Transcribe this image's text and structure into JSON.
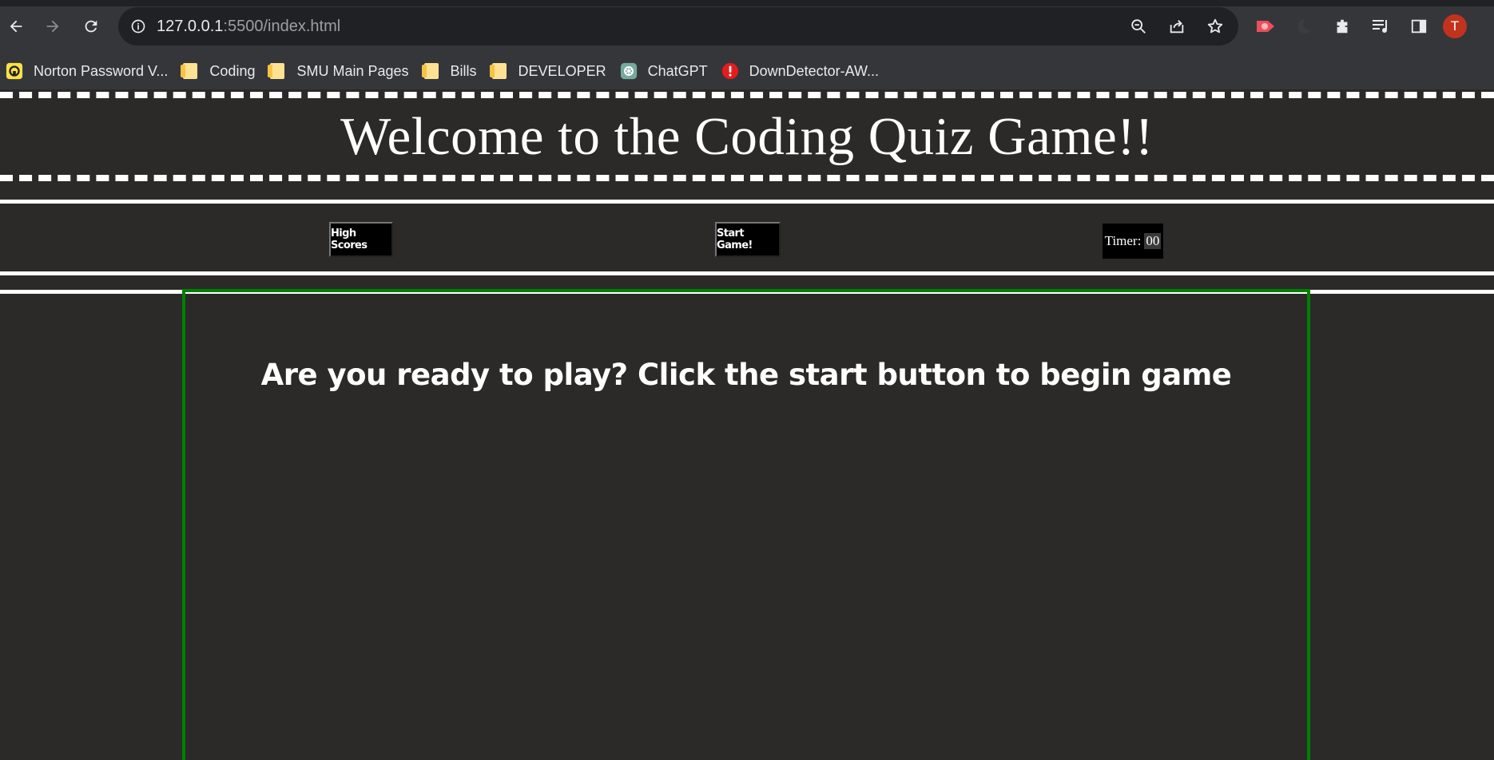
{
  "browser": {
    "url_host": "127.0.0.1",
    "url_rest": ":5500/index.html",
    "avatar_letter": "T",
    "bookmarks": [
      {
        "label": "Norton Password V...",
        "icon": "norton-icon"
      },
      {
        "label": "Coding",
        "icon": "folder-icon"
      },
      {
        "label": "SMU Main Pages",
        "icon": "folder-icon"
      },
      {
        "label": "Bills",
        "icon": "folder-icon"
      },
      {
        "label": "DEVELOPER",
        "icon": "folder-icon"
      },
      {
        "label": "ChatGPT",
        "icon": "chatgpt-icon"
      },
      {
        "label": "DownDetector-AW...",
        "icon": "alert-icon"
      }
    ]
  },
  "page": {
    "title": "Welcome to the Coding Quiz Game!!",
    "high_scores_label": "High Scores",
    "start_label": "Start Game!",
    "timer_label": "Timer:",
    "timer_value": "00",
    "prompt": "Are you ready to play? Click the start button to begin game"
  },
  "colors": {
    "background": "#2b2a28",
    "border_accent": "#008000",
    "text": "#ffffff"
  }
}
